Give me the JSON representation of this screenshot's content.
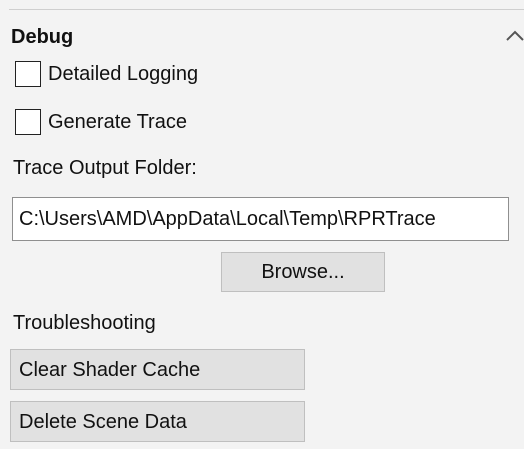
{
  "debug_section": {
    "title": "Debug",
    "collapse_icon": "chevron-up-icon",
    "detailed_logging": {
      "label": "Detailed Logging",
      "checked": false
    },
    "generate_trace": {
      "label": "Generate Trace",
      "checked": false
    },
    "trace_output_folder": {
      "label": "Trace Output Folder:",
      "value": "C:\\Users\\AMD\\AppData\\Local\\Temp\\RPRTrace"
    },
    "browse_label": "Browse..."
  },
  "troubleshooting": {
    "title": "Troubleshooting",
    "clear_shader_cache_label": "Clear Shader Cache",
    "delete_scene_data_label": "Delete Scene Data"
  }
}
